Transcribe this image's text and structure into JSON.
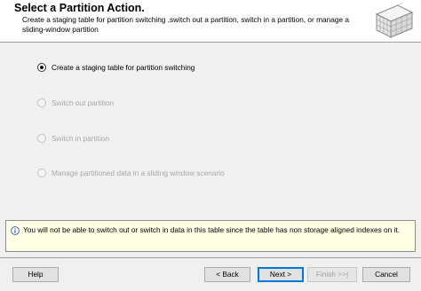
{
  "header": {
    "title": "Select a Partition Action.",
    "description": "Create a staging table for partition switching ,switch out a partition, switch in a partition, or manage a sliding-window partition",
    "graphic_icon": "table-partition-icon"
  },
  "options": [
    {
      "label": "Create a staging table for partition switching",
      "selected": true,
      "enabled": true
    },
    {
      "label": "Switch out partition",
      "selected": false,
      "enabled": false
    },
    {
      "label": "Switch in partition",
      "selected": false,
      "enabled": false
    },
    {
      "label": "Manage partitioned data in a sliding window scenario",
      "selected": false,
      "enabled": false
    }
  ],
  "info": {
    "icon": "info-icon",
    "text": "You will not be able to switch out or switch in data in this table since the table has non storage aligned indexes on it."
  },
  "buttons": {
    "help": "Help",
    "back": "< Back",
    "next": "Next >",
    "finish": "Finish >>|",
    "cancel": "Cancel"
  },
  "colors": {
    "accent": "#0078d7",
    "info_background": "#ffffe6"
  }
}
